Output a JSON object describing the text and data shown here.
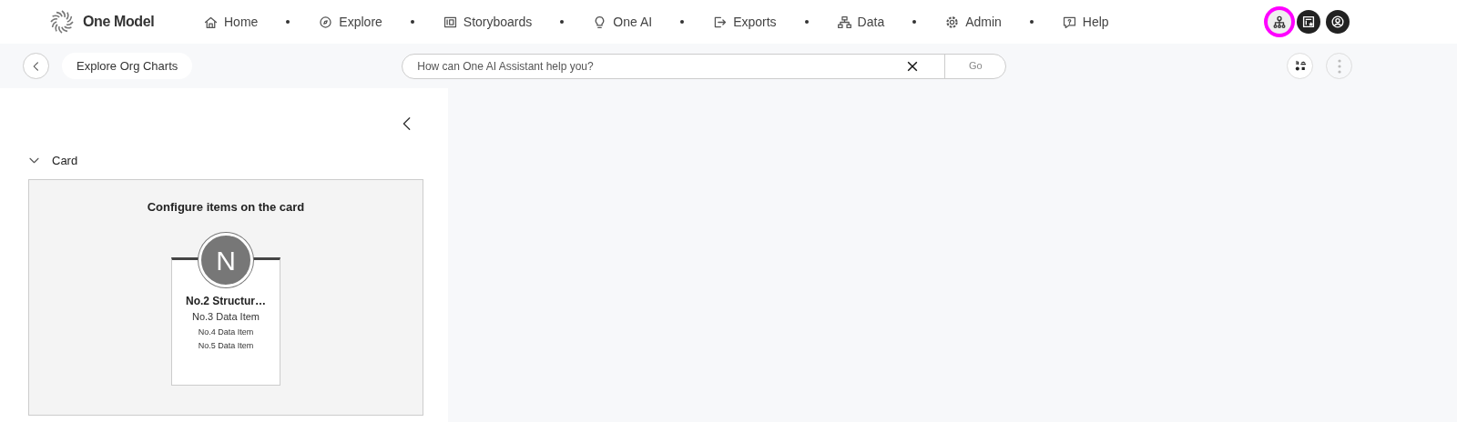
{
  "brand": {
    "name": "One Model"
  },
  "nav": [
    {
      "label": "Home",
      "kind": "home"
    },
    {
      "label": "Explore",
      "kind": "explore"
    },
    {
      "label": "Storyboards",
      "kind": "storyboards"
    },
    {
      "label": "One AI",
      "kind": "bulb"
    },
    {
      "label": "Exports",
      "kind": "exports"
    },
    {
      "label": "Data",
      "kind": "data"
    },
    {
      "label": "Admin",
      "kind": "gear"
    },
    {
      "label": "Help",
      "kind": "help"
    }
  ],
  "header_actions": [
    {
      "kind": "org",
      "highlighted": true
    },
    {
      "kind": "board",
      "highlighted": false
    },
    {
      "kind": "user",
      "highlighted": false
    }
  ],
  "toolbar": {
    "page_title": "Explore Org Charts",
    "search": {
      "placeholder": "How can One AI Assistant help you?",
      "button": "Go"
    }
  },
  "panel": {
    "section": {
      "title": "Card",
      "expanded": true,
      "heading": "Configure items on the card",
      "card": {
        "avatar": "N",
        "title": "No.2 Structur…",
        "lines": [
          "No.3 Data Item",
          "No.4 Data Item",
          "No.5 Data Item"
        ]
      }
    }
  }
}
